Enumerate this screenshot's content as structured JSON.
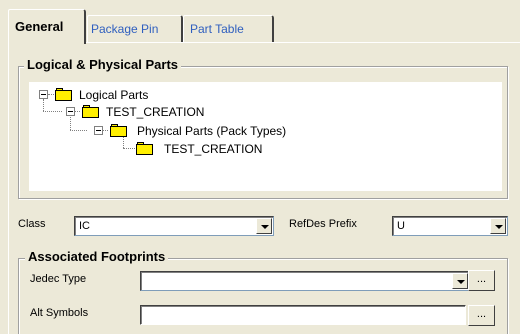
{
  "tabs": [
    {
      "label": "General",
      "active": true
    },
    {
      "label": "Package Pin",
      "active": false
    },
    {
      "label": "Part Table",
      "active": false
    }
  ],
  "logical_physical": {
    "title": "Logical & Physical Parts",
    "tree": [
      {
        "label": "Logical Parts",
        "level": 0,
        "expanded": true
      },
      {
        "label": "TEST_CREATION",
        "level": 1,
        "expanded": true
      },
      {
        "label": "Physical Parts (Pack Types)",
        "level": 2,
        "expanded": true
      },
      {
        "label": "TEST_CREATION",
        "level": 3,
        "expanded": false
      }
    ]
  },
  "class_field": {
    "label": "Class",
    "value": "IC"
  },
  "refdes_field": {
    "label": "RefDes Prefix",
    "value": "U"
  },
  "footprints": {
    "title": "Associated Footprints",
    "jedec": {
      "label": "Jedec Type",
      "value": "",
      "browse_label": "..."
    },
    "alt_symbols": {
      "label": "Alt Symbols",
      "value": "",
      "browse_label": "..."
    }
  },
  "colors": {
    "window_bg": "#ece9d8",
    "tab_link": "#2f5fbf",
    "folder": "#ffef00"
  }
}
